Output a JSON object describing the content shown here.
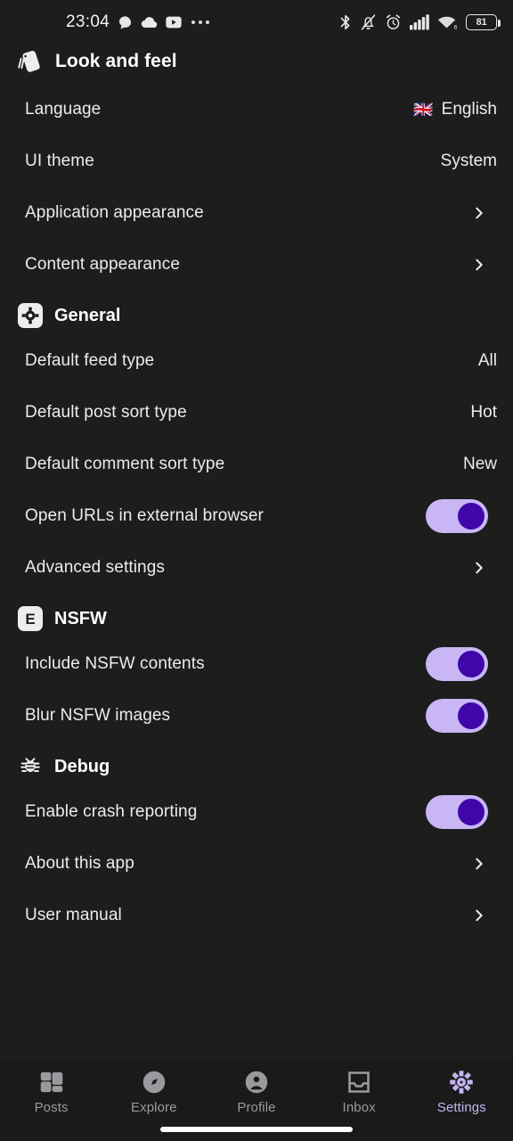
{
  "statusbar": {
    "time": "23:04",
    "left_icons": [
      "chat-bubble-icon",
      "cloud-icon",
      "youtube-icon",
      "overflow-dots-icon"
    ],
    "right_icons": [
      "bluetooth-icon",
      "notifications-muted-icon",
      "alarm-icon",
      "cellular-signal-icon",
      "wifi-icon"
    ],
    "battery_percent": "81",
    "wifi_generation": "6"
  },
  "header": {
    "icon": "device-shake-icon",
    "title": "Look and feel"
  },
  "sections": [
    {
      "id": "look-and-feel",
      "has_header": false,
      "rows": [
        {
          "label": "Language",
          "type": "value",
          "value": "English",
          "flag": "🇬🇧"
        },
        {
          "label": "UI theme",
          "type": "value",
          "value": "System"
        },
        {
          "label": "Application appearance",
          "type": "chevron"
        },
        {
          "label": "Content appearance",
          "type": "chevron"
        }
      ]
    },
    {
      "id": "general",
      "has_header": true,
      "header_label": "General",
      "header_icon": "gear-badge-icon",
      "rows": [
        {
          "label": "Default feed type",
          "type": "value",
          "value": "All"
        },
        {
          "label": "Default post sort type",
          "type": "value",
          "value": "Hot"
        },
        {
          "label": "Default comment sort type",
          "type": "value",
          "value": "New"
        },
        {
          "label": "Open URLs in external browser",
          "type": "toggle",
          "toggle_on": true
        },
        {
          "label": "Advanced settings",
          "type": "chevron"
        }
      ]
    },
    {
      "id": "nsfw",
      "has_header": true,
      "header_label": "NSFW",
      "header_icon": "explicit-badge-icon",
      "header_badge_text": "E",
      "rows": [
        {
          "label": "Include NSFW contents",
          "type": "toggle",
          "toggle_on": true
        },
        {
          "label": "Blur NSFW images",
          "type": "toggle",
          "toggle_on": true
        }
      ]
    },
    {
      "id": "debug",
      "has_header": true,
      "header_label": "Debug",
      "header_icon": "bug-icon",
      "rows": [
        {
          "label": "Enable crash reporting",
          "type": "toggle",
          "toggle_on": true
        },
        {
          "label": "About this app",
          "type": "chevron"
        },
        {
          "label": "User manual",
          "type": "chevron"
        }
      ]
    }
  ],
  "bottom_nav": {
    "items": [
      {
        "label": "Posts",
        "icon": "grid-icon",
        "active": false
      },
      {
        "label": "Explore",
        "icon": "compass-icon",
        "active": false
      },
      {
        "label": "Profile",
        "icon": "person-circle-icon",
        "active": false
      },
      {
        "label": "Inbox",
        "icon": "inbox-tray-icon",
        "active": false
      },
      {
        "label": "Settings",
        "icon": "gear-icon",
        "active": true
      }
    ]
  },
  "colors": {
    "background": "#1d1d1d",
    "navbar_background": "#1a1a1a",
    "text_primary": "#ececed",
    "text_muted": "#9a9a9e",
    "accent": "#c4b5f0",
    "toggle_track": "#c8b6f5",
    "toggle_knob": "#3f07a8"
  }
}
